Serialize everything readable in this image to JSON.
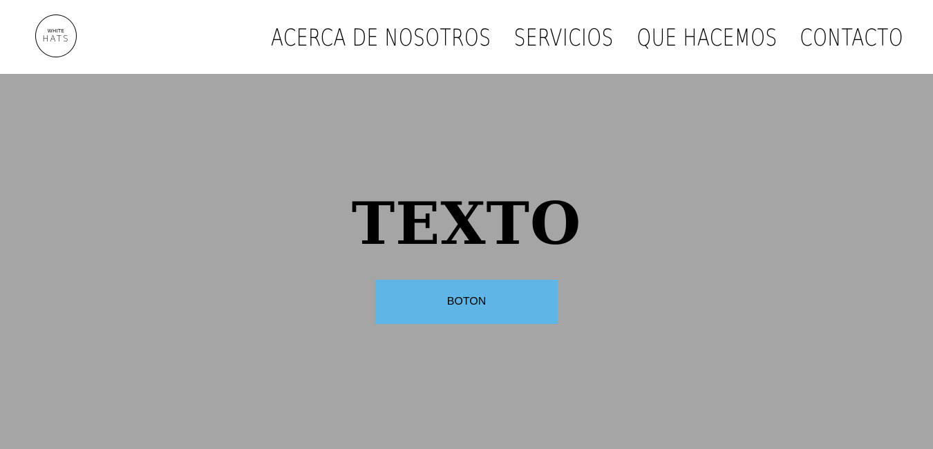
{
  "brand": {
    "logo_top": "WHITE",
    "logo_main": "HATS"
  },
  "nav": {
    "items": [
      {
        "label": "ACERCA DE NOSOTROS"
      },
      {
        "label": "SERVICIOS"
      },
      {
        "label": "QUE HACEMOS"
      },
      {
        "label": "CONTACTO"
      }
    ]
  },
  "hero": {
    "title": "TEXTO",
    "button_label": "BOTON"
  },
  "colors": {
    "header_bg": "#ffffff",
    "hero_bg": "#a5a5a5",
    "button_bg": "#5eb5e6",
    "text": "#000000"
  }
}
